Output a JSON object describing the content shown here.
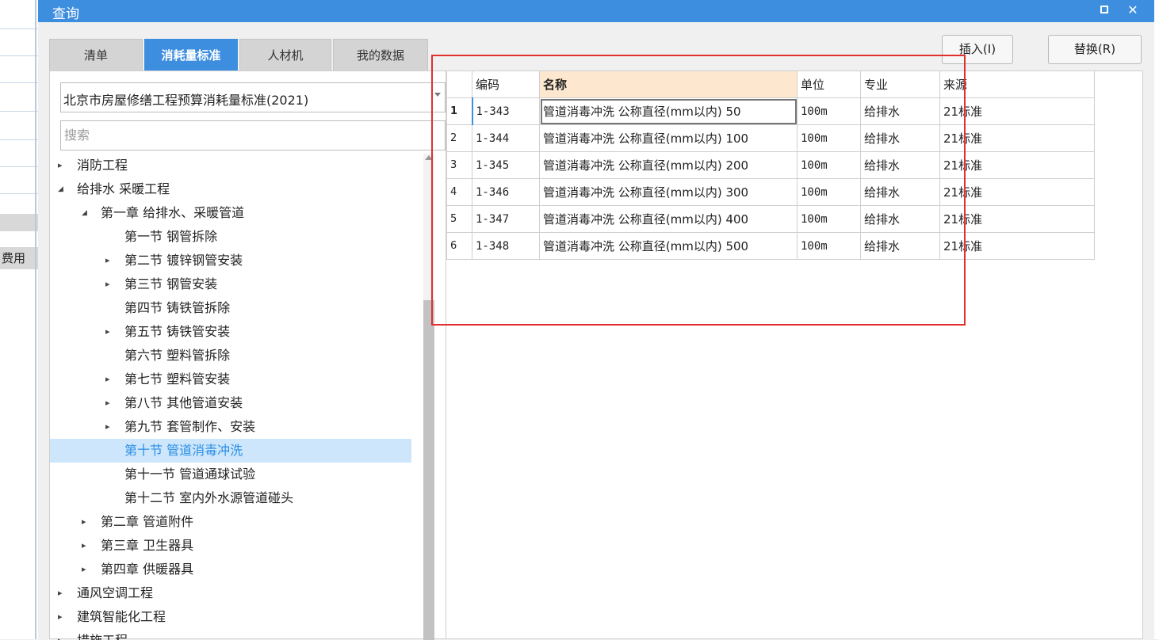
{
  "background": {
    "fee_label": "费用"
  },
  "dialog": {
    "title": "查询",
    "restore_icon": "restore-icon",
    "close_label": "✕"
  },
  "tabs": [
    {
      "label": "清单",
      "active": false
    },
    {
      "label": "消耗量标准",
      "active": true
    },
    {
      "label": "人材机",
      "active": false
    },
    {
      "label": "我的数据",
      "active": false
    }
  ],
  "buttons": {
    "insert": "插入(I)",
    "replace": "替换(R)"
  },
  "standard_select": {
    "value": "北京市房屋修缮工程预算消耗量标准(2021)"
  },
  "search": {
    "placeholder": "搜索",
    "value": ""
  },
  "tree": [
    {
      "label": "消防工程",
      "expander": "▸"
    },
    {
      "label": "给排水 采暖工程",
      "expander": "◢"
    },
    {
      "label": "第一章 给排水、采暖管道",
      "expander": "◢"
    },
    {
      "label": "第一节 钢管拆除",
      "expander": ""
    },
    {
      "label": "第二节 镀锌钢管安装",
      "expander": "▸"
    },
    {
      "label": "第三节 钢管安装",
      "expander": "▸"
    },
    {
      "label": "第四节 铸铁管拆除",
      "expander": ""
    },
    {
      "label": "第五节 铸铁管安装",
      "expander": "▸"
    },
    {
      "label": "第六节 塑料管拆除",
      "expander": ""
    },
    {
      "label": "第七节 塑料管安装",
      "expander": "▸"
    },
    {
      "label": "第八节 其他管道安装",
      "expander": "▸"
    },
    {
      "label": "第九节 套管制作、安装",
      "expander": "▸"
    },
    {
      "label": "第十节 管道消毒冲洗",
      "expander": "",
      "selected": true
    },
    {
      "label": "第十一节 管道通球试验",
      "expander": ""
    },
    {
      "label": "第十二节 室内外水源管道碰头",
      "expander": ""
    },
    {
      "label": "第二章 管道附件",
      "expander": "▸"
    },
    {
      "label": "第三章 卫生器具",
      "expander": "▸"
    },
    {
      "label": "第四章 供暖器具",
      "expander": "▸"
    },
    {
      "label": "通风空调工程",
      "expander": "▸"
    },
    {
      "label": "建筑智能化工程",
      "expander": "▸"
    },
    {
      "label": "措施工程",
      "expander": "▸"
    }
  ],
  "grid": {
    "columns": [
      "编码",
      "名称",
      "单位",
      "专业",
      "来源"
    ],
    "rows": [
      {
        "num": "1",
        "code": "1-343",
        "name": "管道消毒冲洗 公称直径(mm以内) 50",
        "unit": "100m",
        "major": "给排水",
        "source": "21标准"
      },
      {
        "num": "2",
        "code": "1-344",
        "name": "管道消毒冲洗 公称直径(mm以内) 100",
        "unit": "100m",
        "major": "给排水",
        "source": "21标准"
      },
      {
        "num": "3",
        "code": "1-345",
        "name": "管道消毒冲洗 公称直径(mm以内) 200",
        "unit": "100m",
        "major": "给排水",
        "source": "21标准"
      },
      {
        "num": "4",
        "code": "1-346",
        "name": "管道消毒冲洗 公称直径(mm以内) 300",
        "unit": "100m",
        "major": "给排水",
        "source": "21标准"
      },
      {
        "num": "5",
        "code": "1-347",
        "name": "管道消毒冲洗 公称直径(mm以内) 400",
        "unit": "100m",
        "major": "给排水",
        "source": "21标准"
      },
      {
        "num": "6",
        "code": "1-348",
        "name": "管道消毒冲洗 公称直径(mm以内) 500",
        "unit": "100m",
        "major": "给排水",
        "source": "21标准"
      }
    ]
  }
}
